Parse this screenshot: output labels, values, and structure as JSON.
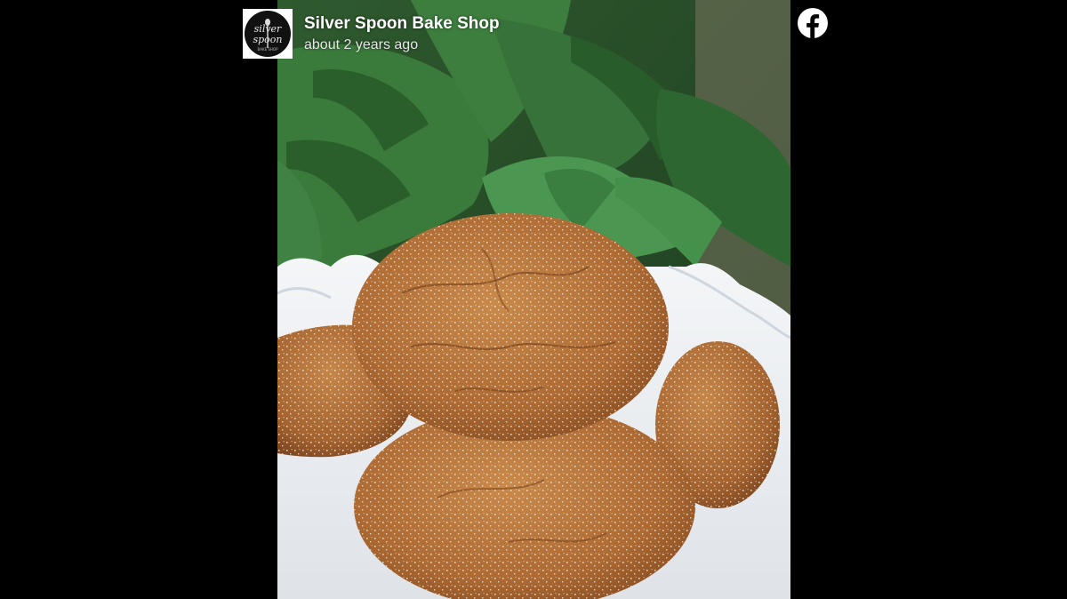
{
  "post": {
    "page_name": "Silver Spoon Bake Shop",
    "timestamp": "about 2 years ago",
    "avatar_icon": "silver-spoon-logo",
    "platform_icon": "facebook-icon"
  },
  "colors": {
    "background": "#000000",
    "brand_white": "#ffffff",
    "cookie": "#b8743a",
    "leaf": "#2f6a35"
  }
}
